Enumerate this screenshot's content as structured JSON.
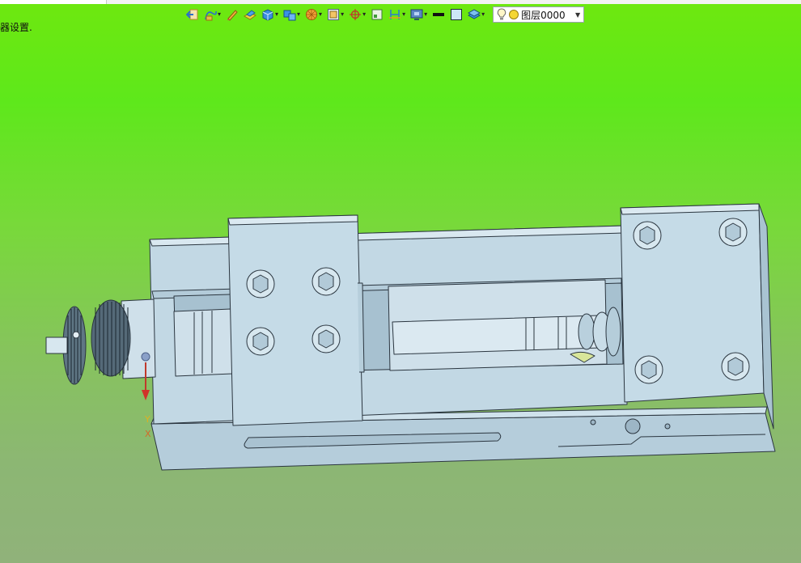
{
  "status": {
    "text": "器设置."
  },
  "toolbar": {
    "tools": [
      {
        "icon": "exit-sketch-icon",
        "dropdown": false
      },
      {
        "icon": "curve-tools-icon",
        "dropdown": true
      },
      {
        "icon": "pencil-icon",
        "dropdown": false
      },
      {
        "icon": "surface-icon",
        "dropdown": false
      },
      {
        "icon": "solid-cube-icon",
        "dropdown": true
      },
      {
        "icon": "assembly-icon",
        "dropdown": true
      },
      {
        "icon": "render-ball-icon",
        "dropdown": true
      },
      {
        "icon": "view-frame-icon",
        "dropdown": true
      },
      {
        "icon": "pick-filter-icon",
        "dropdown": true
      },
      {
        "icon": "datum-plane-icon",
        "dropdown": false
      },
      {
        "icon": "measure-icon",
        "dropdown": true
      },
      {
        "icon": "display-mode-icon",
        "dropdown": true
      },
      {
        "icon": "line-color-icon",
        "dropdown": false
      },
      {
        "icon": "fill-color-icon",
        "dropdown": false
      },
      {
        "icon": "layer-manager-icon",
        "dropdown": true
      }
    ],
    "layer_select": {
      "bulb_icon": "lightbulb-icon",
      "status_icon": "yellow-circle-icon",
      "value": "图层0000"
    }
  },
  "viewport": {
    "background_top": "#5ee81b",
    "background_bottom": "#90b27a",
    "model_color": "#c2d8e4",
    "axis_labels": {
      "y": "Y",
      "x": "X"
    }
  }
}
